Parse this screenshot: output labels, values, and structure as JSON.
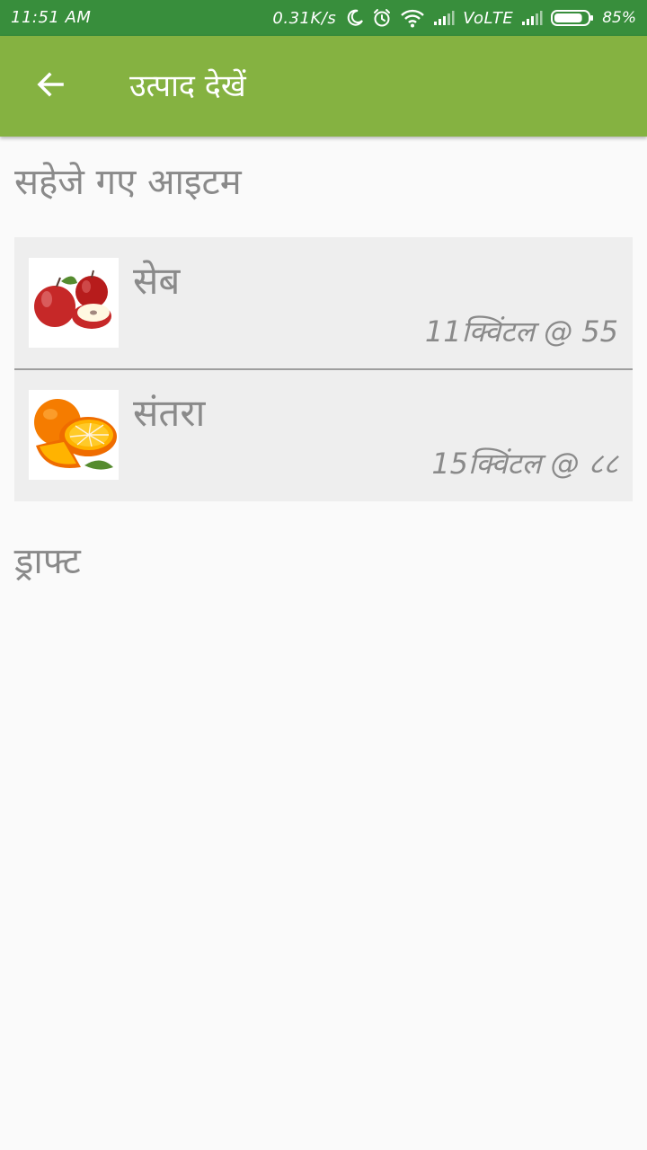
{
  "status_bar": {
    "time": "11:51 AM",
    "network_speed": "0.31K/s",
    "volte": "VoLTE",
    "battery_percent": "85%",
    "battery_level": 0.85
  },
  "toolbar": {
    "title": "उत्पाद देखें",
    "back_icon": "arrow-left-icon"
  },
  "sections": {
    "saved_title": "सहेजे गए आइटम",
    "drafts_title": "ड्राफ्ट"
  },
  "saved_items": [
    {
      "name": "सेब",
      "detail": "11क्विंटल @ 55",
      "image_icon": "apples-image"
    },
    {
      "name": "संतरा",
      "detail": "15क्विंटल @ ८८",
      "image_icon": "oranges-image"
    }
  ],
  "colors": {
    "status_bar": "#388e3c",
    "toolbar": "#85b241",
    "background": "#fafafa",
    "list_background": "#eeeeee",
    "text_secondary": "#8a8a8a"
  }
}
